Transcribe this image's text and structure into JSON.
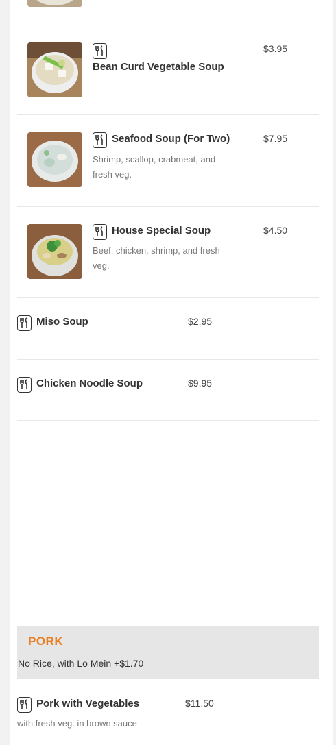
{
  "icons": {
    "dish": "fork-knife-icon"
  },
  "colors": {
    "section_accent": "#e87e22",
    "section_band": "#e6e6e6"
  },
  "items": [
    {
      "name": "Bean Curd Vegetable Soup",
      "price": "$3.95",
      "has_image": true
    },
    {
      "name": "Seafood Soup (For Two)",
      "price": "$7.95",
      "description": "Shrimp, scallop, crabmeat, and fresh veg.",
      "has_image": true
    },
    {
      "name": "House Special Soup",
      "price": "$4.50",
      "description": "Beef, chicken, shrimp, and fresh veg.",
      "has_image": true
    },
    {
      "name": "Miso Soup",
      "price": "$2.95",
      "has_image": false
    },
    {
      "name": "Chicken Noodle Soup",
      "price": "$9.95",
      "has_image": false
    }
  ],
  "section": {
    "title": "PORK",
    "note": "No Rice, with Lo Mein +$1.70",
    "items": [
      {
        "name": "Pork with Vegetables",
        "price": "$11.50",
        "description": "with fresh veg. in brown sauce"
      }
    ]
  }
}
